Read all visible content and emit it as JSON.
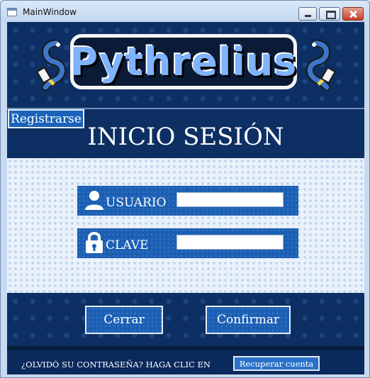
{
  "window": {
    "title": "MainWindow"
  },
  "logo": {
    "text": "Pythrelius"
  },
  "header": {
    "register_label": "Registrarse",
    "page_title": "INICIO SESIÓN"
  },
  "form": {
    "username_label": "USUARIO",
    "username_value": "",
    "password_label": "CLAVE",
    "password_value": ""
  },
  "actions": {
    "close_label": "Cerrar",
    "confirm_label": "Confirmar"
  },
  "footer": {
    "forgot_text": "¿OLVIDÓ SU CONTRASEÑA? HAGA CLIC EN",
    "recover_label": "Recuperar cuenta"
  },
  "colors": {
    "background": "#0d2f63",
    "button": "#1b5fb4",
    "form_bg": "#e9f1fb"
  },
  "icons": [
    "user-icon",
    "lock-icon",
    "snake-icon"
  ]
}
